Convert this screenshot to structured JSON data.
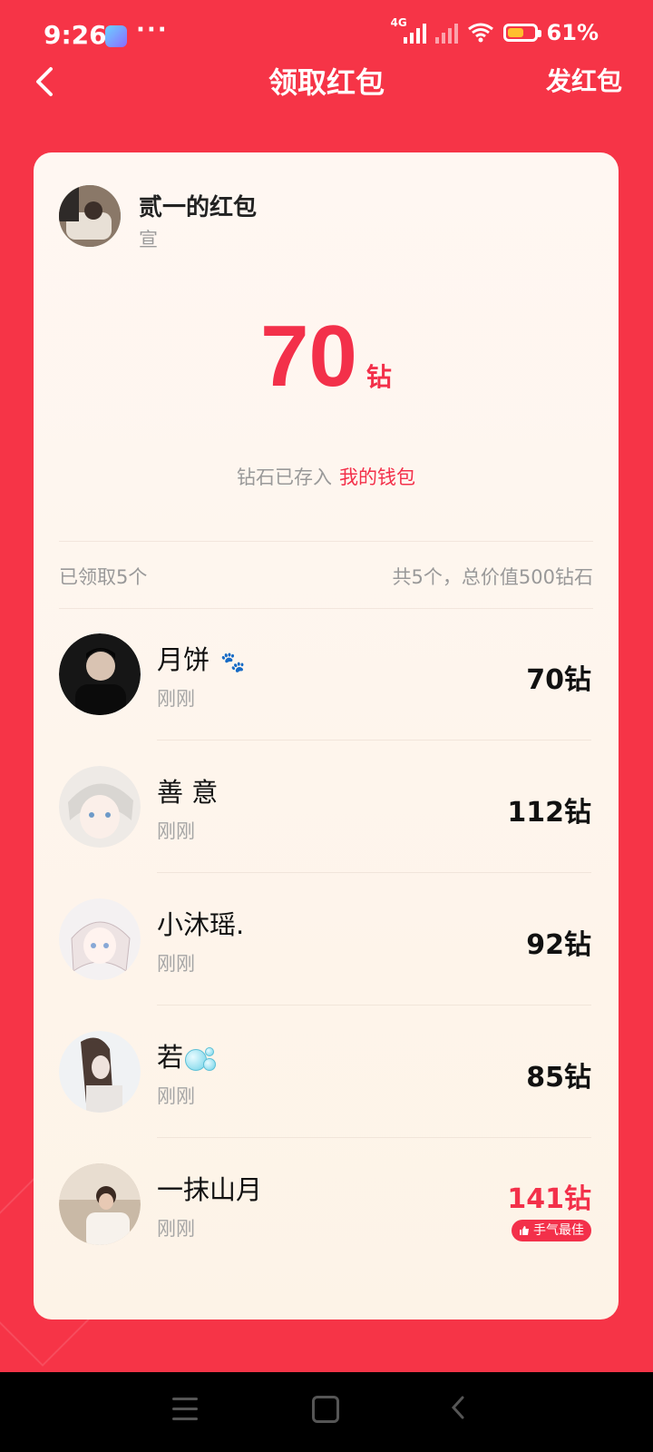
{
  "status_bar": {
    "time": "9:26",
    "dots": "···",
    "network": "4G",
    "battery_text": "61%",
    "battery_level": 0.61
  },
  "header": {
    "title": "领取红包",
    "action": "发红包"
  },
  "sender": {
    "name": "贰一的红包",
    "sub": "宣"
  },
  "received": {
    "amount": "70",
    "unit": "钻",
    "stored_prefix": "钻石已存入",
    "stored_link": "我的钱包"
  },
  "summary": {
    "left": "已领取5个",
    "right": "共5个，总价值500钻石"
  },
  "claims": [
    {
      "name": "月饼",
      "time": "刚刚",
      "amount": "70钻"
    },
    {
      "name": "善 意",
      "time": "刚刚",
      "amount": "112钻"
    },
    {
      "name": "小沐瑶.",
      "time": "刚刚",
      "amount": "92钻"
    },
    {
      "name": "若",
      "time": "刚刚",
      "amount": "85钻"
    },
    {
      "name": "一抹山月",
      "time": "刚刚",
      "amount": "141钻",
      "badge": "手气最佳"
    }
  ],
  "colors": {
    "background": "#f63447",
    "accent": "#f3304a",
    "card": "#fdf3e7"
  }
}
